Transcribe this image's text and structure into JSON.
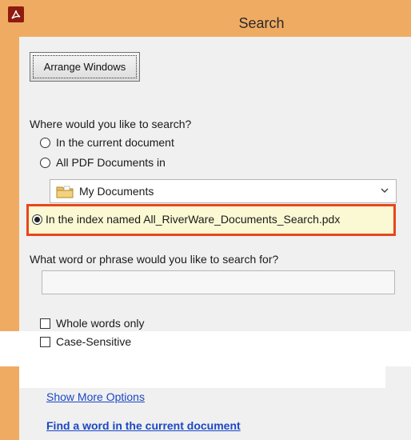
{
  "window": {
    "title": "Search",
    "icon": "acrobat-icon"
  },
  "toolbar": {
    "arrange_label": "Arrange Windows"
  },
  "search_location": {
    "question": "Where would you like to search?",
    "options": [
      {
        "label": "In the current document",
        "selected": false
      },
      {
        "label": "All PDF Documents in",
        "selected": false
      },
      {
        "label": "In the index named All_RiverWare_Documents_Search.pdx",
        "selected": true
      }
    ],
    "folder_select": {
      "value": "My Documents",
      "icon": "folder-icon"
    }
  },
  "search_phrase": {
    "question": "What word or phrase would you like to search for?",
    "value": ""
  },
  "options": {
    "whole_words": {
      "label": "Whole words only",
      "checked": false
    },
    "case_sensitive": {
      "label": "Case-Sensitive",
      "checked": false
    }
  },
  "links": {
    "more_options": "Show More Options",
    "find_in_document": "Find a word in the current document"
  },
  "colors": {
    "title_bar": "#f0ab63",
    "highlight_border": "#e8461c",
    "link": "#1b48c4"
  }
}
